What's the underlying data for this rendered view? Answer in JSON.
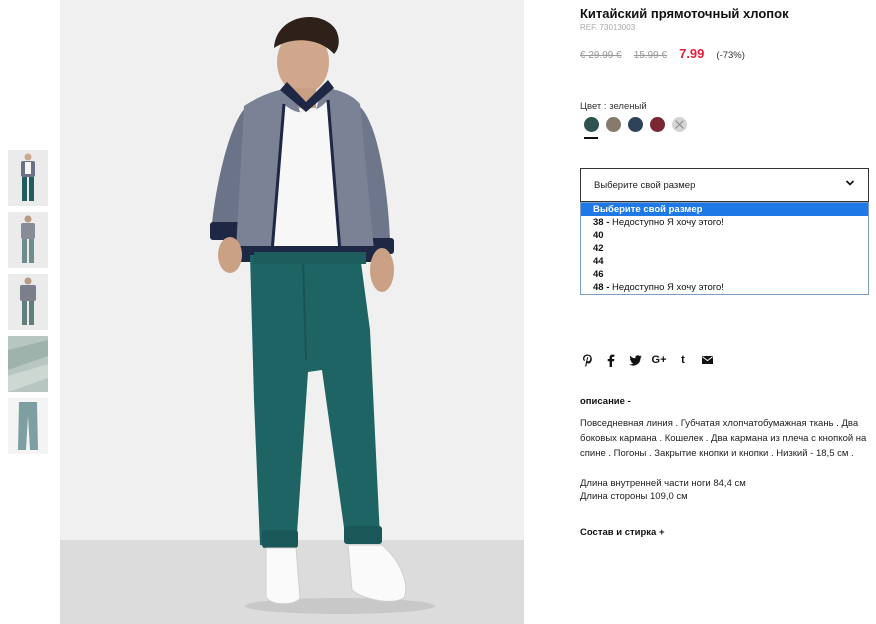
{
  "product": {
    "title": "Китайский прямоточный хлопок",
    "ref": "REF. 73013003",
    "price_original": "€ 29.99 €",
    "price_previous": "15.99 €",
    "price_current": "7.99",
    "discount": "(-73%)"
  },
  "color": {
    "label": "Цвет : зеленый",
    "swatches": [
      "#2f5150",
      "#857a6c",
      "#2f4358",
      "#7a2733",
      "unavailable"
    ]
  },
  "size": {
    "placeholder": "Выберите свой размер",
    "options": [
      {
        "size": "Выберите свой размер",
        "note": "",
        "selected": true
      },
      {
        "size": "38 -",
        "note": "Недоступно Я хочу этого!"
      },
      {
        "size": "40",
        "note": ""
      },
      {
        "size": "42",
        "note": ""
      },
      {
        "size": "44",
        "note": ""
      },
      {
        "size": "46",
        "note": ""
      },
      {
        "size": "48 -",
        "note": "Недоступно Я хочу этого!"
      }
    ]
  },
  "social": {
    "icons": [
      "pinterest-icon",
      "facebook-icon",
      "twitter-icon",
      "google-plus-icon",
      "tumblr-icon",
      "email-icon"
    ],
    "google_plus_label": "G+",
    "tumblr_label": "t"
  },
  "description": {
    "heading": "описание -",
    "text": "Повседневная линия . Губчатая хлопчатобумажная ткань . Два боковых кармана . Кошелек . Два кармана из плеча с кнопкой на спине . Погоны . Закрытие кнопки и кнопки . Низкий - 18,5 см .",
    "inseam": "Длина внутренней части ноги 84,4 см",
    "side_length": "Длина стороны 109,0 см"
  },
  "composition_label": "Состав и стирка +"
}
